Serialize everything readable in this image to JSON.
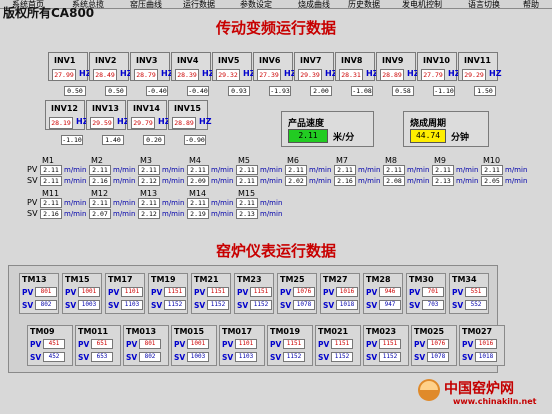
{
  "copyright": "版权所有CA800",
  "menu": [
    {
      "label": "系统首页"
    },
    {
      "label": "系统总揽"
    },
    {
      "label": "窑压曲线"
    },
    {
      "label": "运行数据"
    },
    {
      "label": "参数设定"
    },
    {
      "label": "烧成曲线"
    },
    {
      "label": "历史数据"
    },
    {
      "label": "发电机控制"
    },
    {
      "label": "语言切换"
    },
    {
      "label": "帮助"
    }
  ],
  "inverter_section": {
    "title": "传动变频运行数据",
    "unit": "HZ",
    "inverters": [
      {
        "name": "INV1",
        "value": "27.99",
        "offset": "0.50"
      },
      {
        "name": "INV2",
        "value": "28.49",
        "offset": "0.50"
      },
      {
        "name": "INV3",
        "value": "28.79",
        "offset": "-0.40"
      },
      {
        "name": "INV4",
        "value": "28.39",
        "offset": "-0.40"
      },
      {
        "name": "INV5",
        "value": "29.32",
        "offset": "0.93"
      },
      {
        "name": "INV6",
        "value": "27.39",
        "offset": "-1.93"
      },
      {
        "name": "INV7",
        "value": "29.39",
        "offset": "2.00"
      },
      {
        "name": "INV8",
        "value": "28.31",
        "offset": "-1.08"
      },
      {
        "name": "INV9",
        "value": "28.89",
        "offset": "0.58"
      },
      {
        "name": "INV10",
        "value": "27.79",
        "offset": "-1.10"
      },
      {
        "name": "INV11",
        "value": "29.29",
        "offset": "1.50"
      },
      {
        "name": "INV12",
        "value": "28.19",
        "offset": "-1.10"
      },
      {
        "name": "INV13",
        "value": "29.59",
        "offset": "1.40"
      },
      {
        "name": "INV14",
        "value": "29.79",
        "offset": "0.20"
      },
      {
        "name": "INV15",
        "value": "28.89",
        "offset": "-0.90"
      }
    ],
    "product_speed": {
      "label": "产品速度",
      "value": "2.11",
      "unit": "米/分",
      "color": "#22cc22"
    },
    "firing_cycle": {
      "label": "烧成周期",
      "value": "44.74",
      "unit": "分钟",
      "color": "#ffee00"
    },
    "motor_unit": "m/min",
    "pv_label": "PV",
    "sv_label": "SV",
    "motors": [
      {
        "name": "M1",
        "pv": "2.11",
        "sv": "2.11"
      },
      {
        "name": "M2",
        "pv": "2.11",
        "sv": "2.16"
      },
      {
        "name": "M3",
        "pv": "2.11",
        "sv": "2.12"
      },
      {
        "name": "M4",
        "pv": "2.11",
        "sv": "2.09"
      },
      {
        "name": "M5",
        "pv": "2.11",
        "sv": "2.11"
      },
      {
        "name": "M6",
        "pv": "2.11",
        "sv": "2.02"
      },
      {
        "name": "M7",
        "pv": "2.11",
        "sv": "2.16"
      },
      {
        "name": "M8",
        "pv": "2.11",
        "sv": "2.08"
      },
      {
        "name": "M9",
        "pv": "2.11",
        "sv": "2.13"
      },
      {
        "name": "M10",
        "pv": "2.11",
        "sv": "2.05"
      },
      {
        "name": "M11",
        "pv": "2.11",
        "sv": "2.16"
      },
      {
        "name": "M12",
        "pv": "2.11",
        "sv": "2.07"
      },
      {
        "name": "M13",
        "pv": "2.11",
        "sv": "2.12"
      },
      {
        "name": "M14",
        "pv": "2.11",
        "sv": "2.19"
      },
      {
        "name": "M15",
        "pv": "2.11",
        "sv": "2.13"
      }
    ]
  },
  "kiln_section": {
    "title": "窑炉仪表运行数据",
    "pv_label": "PV",
    "sv_label": "SV",
    "meters": [
      {
        "name": "TM13",
        "pv": "801",
        "sv": "802"
      },
      {
        "name": "TM15",
        "pv": "1001",
        "sv": "1003"
      },
      {
        "name": "TM17",
        "pv": "1101",
        "sv": "1103"
      },
      {
        "name": "TM19",
        "pv": "1151",
        "sv": "1152"
      },
      {
        "name": "TM21",
        "pv": "1151",
        "sv": "1152"
      },
      {
        "name": "TM23",
        "pv": "1151",
        "sv": "1152"
      },
      {
        "name": "TM25",
        "pv": "1076",
        "sv": "1078"
      },
      {
        "name": "TM27",
        "pv": "1016",
        "sv": "1018"
      },
      {
        "name": "TM28",
        "pv": "946",
        "sv": "947"
      },
      {
        "name": "TM30",
        "pv": "701",
        "sv": "703"
      },
      {
        "name": "TM34",
        "pv": "551",
        "sv": "552"
      },
      {
        "name": "TM09",
        "pv": "451",
        "sv": "452"
      },
      {
        "name": "TM011",
        "pv": "651",
        "sv": "653"
      },
      {
        "name": "TM013",
        "pv": "801",
        "sv": "802"
      },
      {
        "name": "TM015",
        "pv": "1001",
        "sv": "1003"
      },
      {
        "name": "TM017",
        "pv": "1101",
        "sv": "1103"
      },
      {
        "name": "TM019",
        "pv": "1151",
        "sv": "1152"
      },
      {
        "name": "TM021",
        "pv": "1151",
        "sv": "1152"
      },
      {
        "name": "TM023",
        "pv": "1151",
        "sv": "1152"
      },
      {
        "name": "TM025",
        "pv": "1076",
        "sv": "1078"
      },
      {
        "name": "TM027",
        "pv": "1016",
        "sv": "1018"
      }
    ]
  },
  "watermark": {
    "text": "中国窑炉网",
    "url": "www.chinakiln.net"
  },
  "colors": {
    "accent_red": "#c80000",
    "value_blue": "#0000cc"
  }
}
